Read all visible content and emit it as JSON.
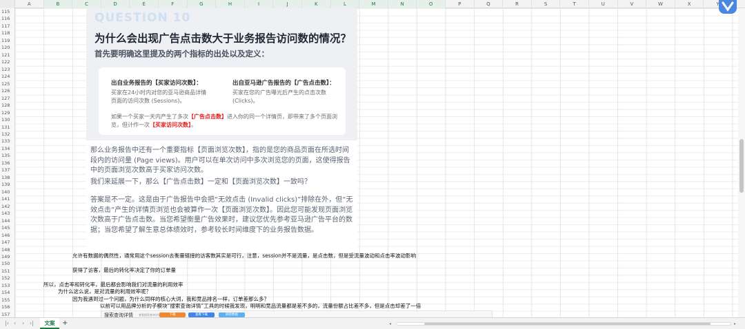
{
  "columns": [
    "A",
    "B",
    "C",
    "D",
    "E",
    "F",
    "G",
    "H",
    "I",
    "J",
    "K",
    "L",
    "M",
    "N",
    "O",
    "P",
    "Q",
    "R",
    "S",
    "T",
    "U",
    "V",
    "W",
    "X",
    "Y"
  ],
  "rows": [
    "115",
    "116",
    "117",
    "118",
    "119",
    "120",
    "121",
    "122",
    "123",
    "124",
    "125",
    "126",
    "127",
    "128",
    "129",
    "130",
    "131",
    "132",
    "133",
    "134",
    "135",
    "136",
    "137",
    "138",
    "139",
    "140",
    "141",
    "142",
    "143",
    "144",
    "145",
    "146",
    "147",
    "148",
    "149",
    "150",
    "151",
    "152",
    "153",
    "154",
    "155",
    "156",
    "157"
  ],
  "embed": {
    "watermark": "QUESTION 10",
    "title": "为什么会出现广告点击数大于业务报告访问数的情况？",
    "subtitle": "首先要明确这里提及的两个指标的出处以及定义：",
    "card": {
      "left_head": "出自业务报告的【买家访问次数】：",
      "left_body": "买家在24小时内对您的亚马逊商品详情页面的访问次数 (Sessions)。",
      "right_head": "出自亚马逊广告报告的【广告点击数】：",
      "right_body": "买家在您的广告曝光后产生的点击次数(Clicks)。",
      "note_a": "如果一个买家一天内产生了多次",
      "note_b": "【广告点击数】",
      "note_c": "进入你的同一个详情页，即带来了多个页面浏览，但计作一次",
      "note_d": "【买家访问次数】",
      "note_e": "。"
    },
    "p1": "那么业务报告中还有一个重要指标【页面浏览次数】，指的是您的商品页面在所选时间段内的访问量 (Page views)。用户可以在单次访问中多次浏览您的页面，这使得报告中的页面浏览次数高于买家访问次数。",
    "p2": "我们来延展一下，那么【广告点击数】一定和【页面浏览次数】一致吗？",
    "p3": "答案是不一定。这是由于广告报告中会把“无效点击 (Invalid clicks)”排除在外，但“无效点击”产生的详情页浏览也会被算作一次【页面浏览次数】。因此您可能发现页面浏览次数高于广告点击数。当您希望衡量广告效果时，建议您优先参考亚马逊广告平台的数据；当您希望了解生意总体绩效时，参考较长时间维度下的业务报告数据。"
  },
  "cells": {
    "r149": "允许有数据的偶然性，通常用这个session去衡量链接的访客数其实是可行，注意，session并不是流量，是点击数，但是受流量波动和点击率波动影响",
    "r151": "获得了访客，最后的转化率决定了你的订单量",
    "r153": "所以，点击率和转化率，最后都会影响我们对流量的利用效率",
    "r154": "为什么这么说，是对流量的利用效率呢？",
    "r155": "因为我遇到过一个问题，为什么同样的核心大词，我和竞品排名一样，订单差那么多？",
    "r156": "以前可以用品牌分析的子模块“搜索查询详情”工具的时候我发现，明明和竞品流量都是差不多的，流量份额占比差不多，但是点击却差了一倍"
  },
  "mini": {
    "title": "搜索查询详情",
    "tiny": "查看搜索查询详情",
    "btn1": "下载",
    "btn2": "查看下载",
    "btn3": "刷新数据"
  },
  "tabs": {
    "sheet": "文案",
    "add": "+"
  },
  "colors": {
    "accent": "#1e7a45",
    "red": "#e02020",
    "brand": "#4a87e0",
    "btn_orange": "#f0892e",
    "btn_blue": "#3f86e8",
    "btn_light_blue": "#5ab0f0"
  }
}
